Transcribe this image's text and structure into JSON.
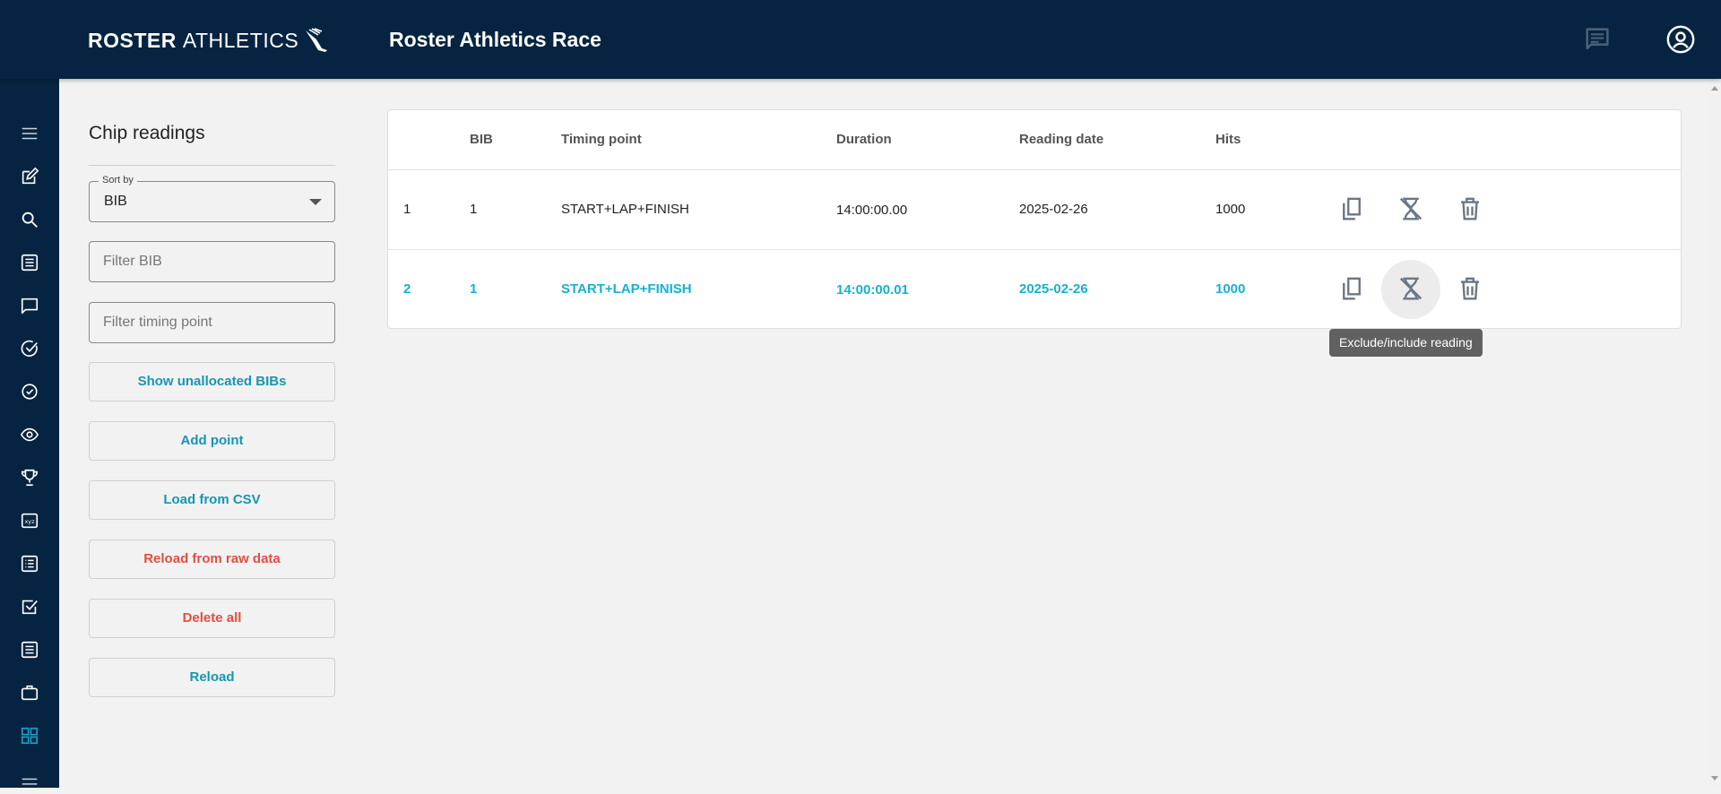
{
  "header": {
    "logo_bold": "ROSTER",
    "logo_light": "ATHLETICS",
    "title": "Roster Athletics Race",
    "chat_icon": "chat-icon",
    "user_icon": "account-circle-icon"
  },
  "sidebar": {
    "icons": [
      "menu-icon",
      "edit-icon",
      "search-icon",
      "list-icon",
      "chat-icon",
      "check-circle-icon",
      "check-circle-icon",
      "eye-icon",
      "trophy-icon",
      "xyz-icon",
      "list-alt-icon",
      "checkbox-icon",
      "document-icon",
      "briefcase-icon",
      "grid-icon",
      "menu-icon"
    ],
    "active_index": 14
  },
  "panel": {
    "title": "Chip readings",
    "sort": {
      "legend": "Sort by",
      "value": "BIB"
    },
    "filter_bib_placeholder": "Filter BIB",
    "filter_timing_placeholder": "Filter timing point",
    "buttons": {
      "show_unallocated": "Show unallocated BIBs",
      "add_point": "Add point",
      "load_csv": "Load from CSV",
      "reload_raw": "Reload from raw data",
      "delete_all": "Delete all",
      "reload": "Reload"
    }
  },
  "table": {
    "headers": [
      "",
      "BIB",
      "Timing point",
      "Duration",
      "Reading date",
      "Hits"
    ],
    "rows": [
      {
        "num": "1",
        "bib": "1",
        "timing_point": "START+LAP+FINISH",
        "duration": "14:00:00.00",
        "reading_date": "2025-02-26",
        "hits": "1000",
        "excluded": false
      },
      {
        "num": "2",
        "bib": "1",
        "timing_point": "START+LAP+FINISH",
        "duration": "14:00:00.01",
        "reading_date": "2025-02-26",
        "hits": "1000",
        "excluded": false
      }
    ],
    "actions": [
      "copy-icon",
      "hourglass-disabled-icon",
      "trash-icon"
    ]
  },
  "tooltip": "Exclude/include reading",
  "colors": {
    "navy": "#062441",
    "accent": "#16b1cf",
    "button_text": "#1696b0",
    "danger": "#e14e3f",
    "active_sidebar": "#1aa3c9"
  }
}
